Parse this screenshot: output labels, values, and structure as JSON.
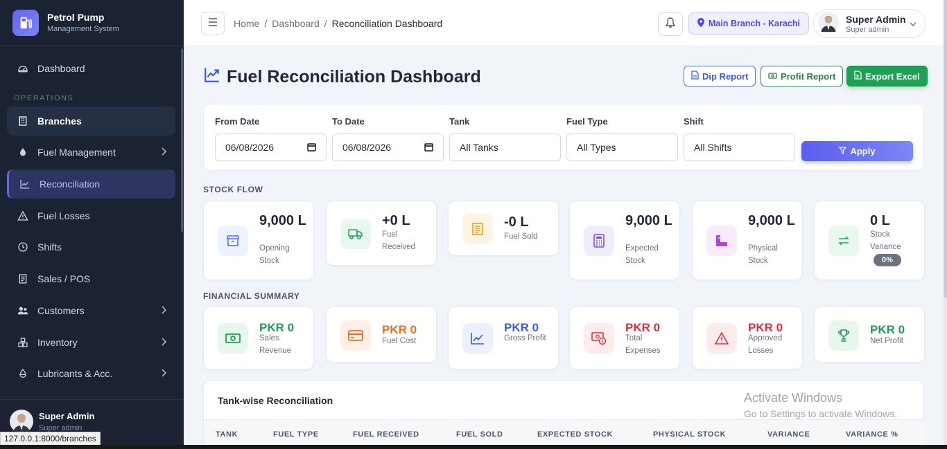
{
  "brand": {
    "title": "Petrol Pump",
    "subtitle": "Management System"
  },
  "sidebar": {
    "section_operations": "OPERATIONS",
    "items": [
      {
        "label": "Dashboard",
        "icon": "gauge-icon"
      },
      {
        "label": "Branches",
        "icon": "building-icon"
      },
      {
        "label": "Fuel Management",
        "icon": "droplet-icon"
      },
      {
        "label": "Reconciliation",
        "icon": "chart-line-icon"
      },
      {
        "label": "Fuel Losses",
        "icon": "warning-icon"
      },
      {
        "label": "Shifts",
        "icon": "clock-icon"
      },
      {
        "label": "Sales / POS",
        "icon": "receipt-icon"
      },
      {
        "label": "Customers",
        "icon": "users-icon"
      },
      {
        "label": "Inventory",
        "icon": "boxes-icon"
      },
      {
        "label": "Lubricants & Acc.",
        "icon": "oil-drop-icon"
      }
    ],
    "footer_user": {
      "name": "Super Admin",
      "role": "Super admin"
    }
  },
  "status_url": "127.0.0.1:8000/branches",
  "topbar": {
    "breadcrumb": [
      "Home",
      "Dashboard",
      "Reconciliation Dashboard"
    ],
    "branch": "Main Branch - Karachi",
    "user": {
      "name": "Super Admin",
      "role": "Super admin"
    }
  },
  "page": {
    "title": "Fuel Reconciliation Dashboard",
    "buttons": {
      "dip": "Dip Report",
      "profit": "Profit Report",
      "excel": "Export Excel"
    }
  },
  "filters": {
    "from": {
      "label": "From Date",
      "value": "06/08/2026"
    },
    "to": {
      "label": "To Date",
      "value": "06/08/2026"
    },
    "tank": {
      "label": "Tank",
      "value": "All Tanks"
    },
    "fuel": {
      "label": "Fuel Type",
      "value": "All Types"
    },
    "shift": {
      "label": "Shift",
      "value": "All Shifts"
    },
    "apply": "Apply"
  },
  "stock_flow": {
    "label": "STOCK FLOW",
    "cards": [
      {
        "value": "9,000 L",
        "label": "Opening Stock",
        "icon": "archive-icon",
        "color": "#4f6ee8"
      },
      {
        "value": "+0 L",
        "label": "Fuel Received",
        "icon": "truck-icon",
        "color": "#22a45d"
      },
      {
        "value": "-0 L",
        "label": "Fuel Sold",
        "icon": "receipt-icon",
        "color": "#e8a21a"
      },
      {
        "value": "9,000 L",
        "label": "Expected Stock",
        "icon": "calculator-icon",
        "color": "#7c4ddb"
      },
      {
        "value": "9,000 L",
        "label": "Physical Stock",
        "icon": "ruler-icon",
        "color": "#b245d6"
      },
      {
        "value": "0 L",
        "label": "Stock Variance",
        "icon": "arrows-exchange-icon",
        "color": "#22a45d",
        "badge": "0%"
      }
    ]
  },
  "financial": {
    "label": "FINANCIAL SUMMARY",
    "cards": [
      {
        "value": "PKR 0",
        "label": "Sales Revenue",
        "icon": "cash-icon",
        "color": "#1f9d55"
      },
      {
        "value": "PKR 0",
        "label": "Fuel Cost",
        "icon": "credit-card-icon",
        "color": "#e07020"
      },
      {
        "value": "PKR 0",
        "label": "Gross Profit",
        "icon": "chart-line-icon",
        "color": "#3b5bdb"
      },
      {
        "value": "PKR 0",
        "label": "Total Expenses",
        "icon": "money-out-icon",
        "color": "#dc2f3a"
      },
      {
        "value": "PKR 0",
        "label": "Approved Losses",
        "icon": "warning-icon",
        "color": "#dc2f3a"
      },
      {
        "value": "PKR 0",
        "label": "Net Profit",
        "icon": "trophy-icon",
        "color": "#1f9d55"
      }
    ]
  },
  "table": {
    "title": "Tank-wise Reconciliation",
    "columns": [
      "TANK",
      "FUEL TYPE",
      "FUEL RECEIVED",
      "FUEL SOLD",
      "EXPECTED STOCK",
      "PHYSICAL STOCK",
      "VARIANCE",
      "VARIANCE %"
    ]
  },
  "watermark": {
    "line1": "Activate Windows",
    "line2": "Go to Settings to activate Windows."
  }
}
